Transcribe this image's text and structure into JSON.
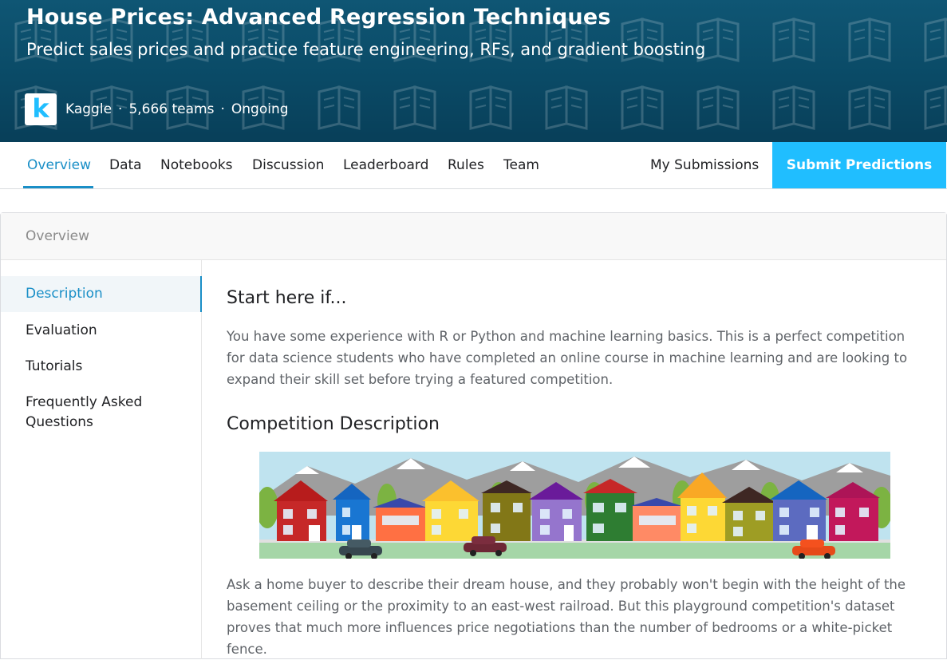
{
  "header": {
    "title": "House Prices: Advanced Regression Techniques",
    "subtitle": "Predict sales prices and practice feature engineering, RFs, and gradient boosting",
    "logo_letter": "k",
    "host": "Kaggle",
    "separator": "·",
    "teams": "5,666 teams",
    "status": "Ongoing"
  },
  "tabs": [
    {
      "label": "Overview"
    },
    {
      "label": "Data"
    },
    {
      "label": "Notebooks"
    },
    {
      "label": "Discussion"
    },
    {
      "label": "Leaderboard"
    },
    {
      "label": "Rules"
    },
    {
      "label": "Team"
    }
  ],
  "my_submissions_label": "My Submissions",
  "submit_label": "Submit Predictions",
  "card": {
    "header_label": "Overview"
  },
  "sidenav": {
    "items": [
      {
        "label": "Description"
      },
      {
        "label": "Evaluation"
      },
      {
        "label": "Tutorials"
      },
      {
        "label": "Frequently Asked Questions"
      }
    ]
  },
  "content": {
    "heading1": "Start here if...",
    "para1": "You have some experience with R or Python and machine learning basics. This is a perfect competition for data science students who have completed an online course in machine learning and are looking to expand their skill set before trying a featured competition.",
    "heading2": "Competition Description",
    "para2": "Ask a home buyer to describe their dream house, and they probably won't begin with the height of the basement ceiling or the proximity to an east-west railroad. But this playground competition's dataset proves that much more influences price negotiations than the number of bedrooms or a white-picket fence."
  },
  "colors": {
    "header_bg": "#0a4a66",
    "accent": "#1a8fc7",
    "submit_bg": "#20beff",
    "kaggle_blue": "#20beff"
  }
}
